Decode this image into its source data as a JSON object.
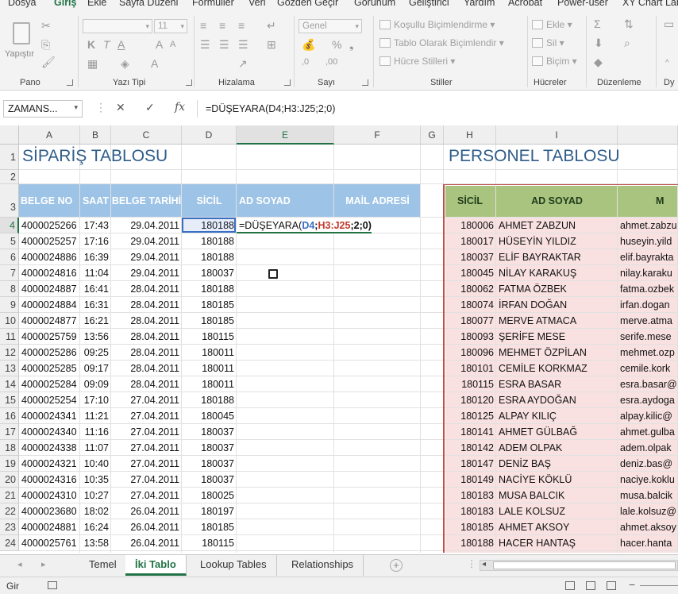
{
  "ribbon": {
    "tabs": [
      "Dosya",
      "Giriş",
      "Ekle",
      "Sayfa Düzeni",
      "Formüller",
      "Veri",
      "Gözden Geçir",
      "Görünüm",
      "Geliştirici",
      "Yardım",
      "Acrobat",
      "Power-user",
      "XY Chart Lab"
    ],
    "active_tab": "Giriş",
    "groups": {
      "pano": "Pano",
      "yazi_tipi": "Yazı Tipi",
      "hizalama": "Hizalama",
      "sayi": "Sayı",
      "stiller": "Stiller",
      "hucreler": "Hücreler",
      "duzenleme": "Düzenleme",
      "dy": "Dy"
    },
    "paste_label": "Yapıştır",
    "font_size": "11",
    "number_format": "Genel",
    "conditional_formatting": "Koşullu Biçimlendirme",
    "format_as_table": "Tablo Olarak Biçimlendir",
    "cell_styles": "Hücre Stilleri",
    "insert": "Ekle",
    "delete": "Sil",
    "format": "Biçim"
  },
  "formula_bar": {
    "name_box": "ZAMANS...",
    "formula": "=DÜŞEYARA(D4;H3:J25;2;0)"
  },
  "columns": [
    "A",
    "B",
    "C",
    "D",
    "E",
    "F",
    "G",
    "H",
    "I"
  ],
  "selected_column": "E",
  "selected_row": "4",
  "rows": [
    "1",
    "2",
    "3",
    "4",
    "5",
    "6",
    "7",
    "8",
    "9",
    "10",
    "11",
    "12",
    "13",
    "14",
    "15",
    "16",
    "17",
    "18",
    "19",
    "20",
    "21",
    "22",
    "23",
    "24"
  ],
  "order_table": {
    "title": "SİPARİŞ TABLOSU",
    "headers": [
      "BELGE NO",
      "SAAT",
      "BELGE TARİHİ",
      "SİCİL",
      "AD SOYAD",
      "MAİL ADRESİ"
    ],
    "formula_cell": {
      "prefix": "=DÜŞEYARA(",
      "ref1": "D4",
      "sep": ";",
      "ref2": "H3:J25",
      "suffix": ";2;0)"
    },
    "data": [
      [
        "4000025266",
        "17:43",
        "29.04.2011",
        "180188"
      ],
      [
        "4000025257",
        "17:16",
        "29.04.2011",
        "180188"
      ],
      [
        "4000024886",
        "16:39",
        "29.04.2011",
        "180188"
      ],
      [
        "4000024816",
        "11:04",
        "29.04.2011",
        "180037"
      ],
      [
        "4000024887",
        "16:41",
        "28.04.2011",
        "180188"
      ],
      [
        "4000024884",
        "16:31",
        "28.04.2011",
        "180185"
      ],
      [
        "4000024877",
        "16:21",
        "28.04.2011",
        "180185"
      ],
      [
        "4000025759",
        "13:56",
        "28.04.2011",
        "180115"
      ],
      [
        "4000025286",
        "09:25",
        "28.04.2011",
        "180011"
      ],
      [
        "4000025285",
        "09:17",
        "28.04.2011",
        "180011"
      ],
      [
        "4000025284",
        "09:09",
        "28.04.2011",
        "180011"
      ],
      [
        "4000025254",
        "17:10",
        "27.04.2011",
        "180188"
      ],
      [
        "4000024341",
        "11:21",
        "27.04.2011",
        "180045"
      ],
      [
        "4000024340",
        "11:16",
        "27.04.2011",
        "180037"
      ],
      [
        "4000024338",
        "11:07",
        "27.04.2011",
        "180037"
      ],
      [
        "4000024321",
        "10:40",
        "27.04.2011",
        "180037"
      ],
      [
        "4000024316",
        "10:35",
        "27.04.2011",
        "180037"
      ],
      [
        "4000024310",
        "10:27",
        "27.04.2011",
        "180025"
      ],
      [
        "4000023680",
        "18:02",
        "26.04.2011",
        "180197"
      ],
      [
        "4000024881",
        "16:24",
        "26.04.2011",
        "180185"
      ],
      [
        "4000025761",
        "13:58",
        "26.04.2011",
        "180115"
      ]
    ]
  },
  "personnel_table": {
    "title": "PERSONEL TABLOSU",
    "headers": [
      "SİCİL",
      "AD SOYAD",
      "M"
    ],
    "data": [
      [
        "180006",
        "AHMET ZABZUN",
        "ahmet.zabzu"
      ],
      [
        "180017",
        "HÜSEYİN YILDIZ",
        "huseyin.yild"
      ],
      [
        "180037",
        "ELİF BAYRAKTAR",
        "elif.bayrakta"
      ],
      [
        "180045",
        "NİLAY KARAKUŞ",
        "nilay.karaku"
      ],
      [
        "180062",
        "FATMA ÖZBEK",
        "fatma.ozbek"
      ],
      [
        "180074",
        "İRFAN DOĞAN",
        "irfan.dogan"
      ],
      [
        "180077",
        "MERVE ATMACA",
        "merve.atma"
      ],
      [
        "180093",
        "ŞERİFE MESE",
        "serife.mese"
      ],
      [
        "180096",
        "MEHMET ÖZPİLAN",
        "mehmet.ozp"
      ],
      [
        "180101",
        "CEMİLE KORKMAZ",
        "cemile.kork"
      ],
      [
        "180115",
        "ESRA BASAR",
        "esra.basar@"
      ],
      [
        "180120",
        "ESRA AYDOĞAN",
        "esra.aydoga"
      ],
      [
        "180125",
        "ALPAY KILIÇ",
        "alpay.kilic@"
      ],
      [
        "180141",
        "AHMET GÜLBAĞ",
        "ahmet.gulba"
      ],
      [
        "180142",
        "ADEM OLPAK",
        "adem.olpak"
      ],
      [
        "180147",
        "DENİZ BAŞ",
        "deniz.bas@"
      ],
      [
        "180149",
        "NACİYE KÖKLÜ",
        "naciye.koklu"
      ],
      [
        "180183",
        "MUSA BALCIK",
        "musa.balcik"
      ],
      [
        "180183",
        "LALE KOLSUZ",
        "lale.kolsuz@"
      ],
      [
        "180185",
        "AHMET AKSOY",
        "ahmet.aksoy"
      ],
      [
        "180188",
        "HACER HANTAŞ",
        "hacer.hanta"
      ]
    ]
  },
  "sheet_tabs": [
    "Temel",
    "İki Tablo",
    "Lookup Tables",
    "Relationships"
  ],
  "active_sheet": "İki Tablo",
  "status": {
    "mode": "Gir"
  },
  "colors": {
    "excel_green": "#217346",
    "header_blue": "#9dc3e6",
    "header_green": "#a9c47f",
    "personnel_fill": "#f9e1e1",
    "title_blue": "#2f5d8a"
  }
}
